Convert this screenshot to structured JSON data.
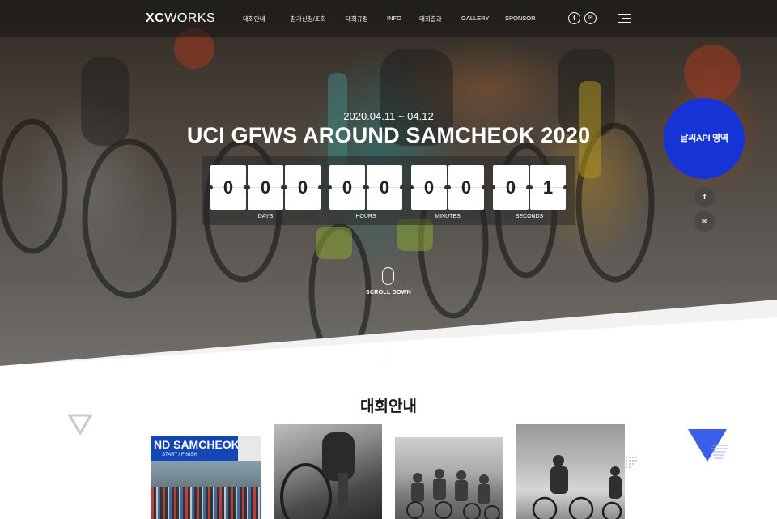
{
  "header": {
    "logo_bold": "XC",
    "logo_light": "WORKS",
    "nav": [
      "대회안내",
      "참가신청/조회",
      "대회규정",
      "INFO",
      "대회결과",
      "GALLERY",
      "SPONSOR"
    ],
    "social": [
      {
        "icon": "facebook-icon",
        "glyph": "f"
      },
      {
        "icon": "mail-icon",
        "glyph": "✉"
      }
    ],
    "menu_icon": "hamburger-menu-icon"
  },
  "hero": {
    "date": "2020.04.11 ~ 04.12",
    "title": "UCI GFWS AROUND SAMCHEOK 2020",
    "countdown": {
      "digits": [
        "0",
        "0",
        "0",
        "0",
        "0",
        "0",
        "0",
        "0",
        "1"
      ],
      "units": [
        "DAYS",
        "HOURS",
        "MINUTES",
        "SECONDS"
      ]
    },
    "weather_label": "날씨API 영역",
    "side_buttons": [
      {
        "icon": "facebook-icon",
        "glyph": "f"
      },
      {
        "icon": "mail-icon",
        "glyph": "✉"
      }
    ],
    "scroll_label": "SCROLL DOWN"
  },
  "intro": {
    "section_title": "대회안내",
    "card1_banner": "ND SAMCHEOK",
    "card1_sub": "START / FINISH"
  },
  "colors": {
    "accent_blue": "#1633d6",
    "banner_blue": "#1546b8",
    "triangle_blue": "#3b5ee8"
  }
}
